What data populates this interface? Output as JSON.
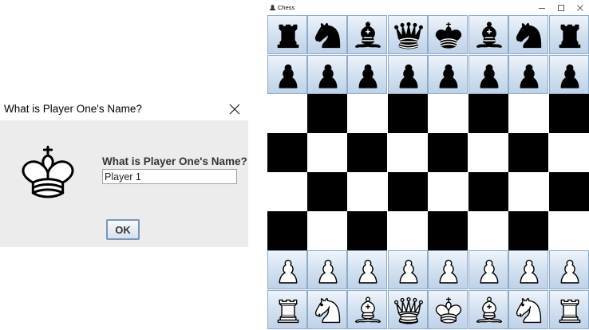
{
  "dialog": {
    "title": "What is Player One's Name?",
    "prompt": "What is Player One's Name?",
    "input_value": "Player 1",
    "ok_label": "OK",
    "icon": "white-king-icon"
  },
  "chess_window": {
    "title": "Chess",
    "controls": [
      "minimize-icon",
      "maximize-icon",
      "close-icon"
    ],
    "board": {
      "ranks": [
        [
          "bR",
          "bN",
          "bB",
          "bQ",
          "bK",
          "bB",
          "bN",
          "bR"
        ],
        [
          "bP",
          "bP",
          "bP",
          "bP",
          "bP",
          "bP",
          "bP",
          "bP"
        ],
        [
          "",
          "",
          "",
          "",
          "",
          "",
          "",
          ""
        ],
        [
          "",
          "",
          "",
          "",
          "",
          "",
          "",
          ""
        ],
        [
          "",
          "",
          "",
          "",
          "",
          "",
          "",
          ""
        ],
        [
          "",
          "",
          "",
          "",
          "",
          "",
          "",
          ""
        ],
        [
          "wP",
          "wP",
          "wP",
          "wP",
          "wP",
          "wP",
          "wP",
          "wP"
        ],
        [
          "wR",
          "wN",
          "wB",
          "wQ",
          "wK",
          "wB",
          "wN",
          "wR"
        ]
      ],
      "colors": {
        "dark": "#000000",
        "light": "#ffffff",
        "piece_tile_top": "#eef4fb",
        "piece_tile_bottom": "#bfd2e8"
      }
    }
  }
}
